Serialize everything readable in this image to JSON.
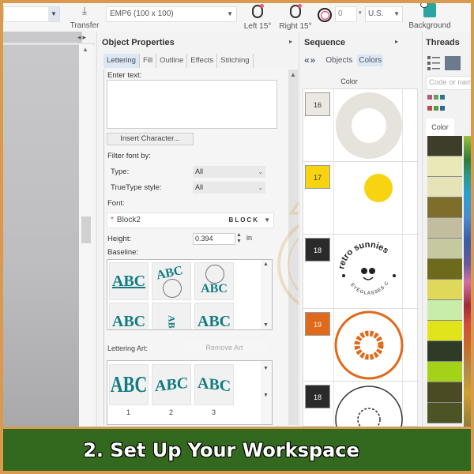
{
  "toolbar": {
    "transfer_label": "Transfer",
    "hoop_value": "EMP6 (100 x 100)",
    "rotate_left_label": "Left 15°",
    "rotate_right_label": "Right 15°",
    "rotation_value": "0",
    "units_value": "U.S.",
    "background_label": "Background"
  },
  "object_properties": {
    "title": "Object Properties",
    "tabs": [
      {
        "label": "Lettering",
        "active": true
      },
      {
        "label": "Fill",
        "active": false
      },
      {
        "label": "Outline",
        "active": false
      },
      {
        "label": "Effects",
        "active": false
      },
      {
        "label": "Stitching",
        "active": false
      }
    ],
    "enter_text_label": "Enter text:",
    "enter_text_value": "",
    "insert_character_label": "Insert Character...",
    "filter_font_label": "Filter font by:",
    "type_label": "Type:",
    "type_value": "All",
    "truetype_label": "TrueType style:",
    "truetype_value": "All",
    "font_label": "Font:",
    "font_value": "Block2",
    "font_preview": "BLOCK",
    "height_label": "Height:",
    "height_value": "0.394",
    "height_unit": "in",
    "baseline_label": "Baseline:",
    "baseline_options": [
      "ABC",
      "ABC",
      "ABC",
      "ABC",
      "AB",
      "ABC"
    ],
    "lettering_art_label": "Lettering Art:",
    "remove_art_label": "Remove Art",
    "lettering_art_options": [
      {
        "text": "ABC",
        "number": "1"
      },
      {
        "text": "ABC",
        "number": "2"
      },
      {
        "text": "ABC",
        "number": "3"
      }
    ]
  },
  "sequence": {
    "title": "Sequence",
    "nav_label": "«»",
    "tabs": [
      {
        "label": "Objects",
        "active": false
      },
      {
        "label": "Colors",
        "active": true
      }
    ],
    "column_header": "Color",
    "rows": [
      {
        "number": "16",
        "color": "#ebe7e1",
        "text_color": "#333333",
        "thumb": "ring-cream"
      },
      {
        "number": "17",
        "color": "#f7d312",
        "text_color": "#333333",
        "thumb": "yellow-circle"
      },
      {
        "number": "18",
        "color": "#2a2a2a",
        "text_color": "#ffffff",
        "thumb": "retro-sunnies-logo",
        "logo_top": "retro sunnies",
        "logo_bottom": "EYEGLASSES CO"
      },
      {
        "number": "19",
        "color": "#e06a1b",
        "text_color": "#ffffff",
        "thumb": "orange-sun-ring"
      },
      {
        "number": "18",
        "color": "#2a2a2a",
        "text_color": "#ffffff",
        "thumb": "black-sun-ring"
      }
    ]
  },
  "threads": {
    "title": "Threads",
    "search_placeholder": "Code or name",
    "column_header": "Color",
    "swatches": [
      "#3d3d2a",
      "#e9e9b8",
      "#e6e4b7",
      "#7e6e2c",
      "#c2bd9f",
      "#c6c8a0",
      "#6e6a1c",
      "#e0d85a",
      "#c8ecaa",
      "#e1e41a",
      "#2e3b27",
      "#a3d219",
      "#4a4b23",
      "#4c5425"
    ]
  },
  "banner": {
    "text": "2. Set Up Your Workspace"
  }
}
